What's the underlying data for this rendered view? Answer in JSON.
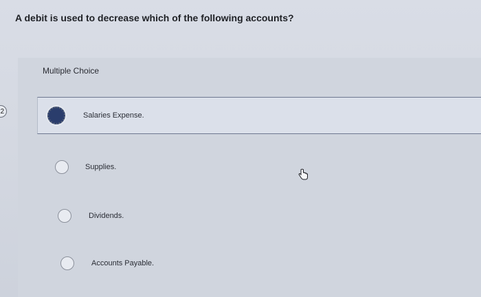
{
  "question": {
    "text": "A debit is used to decrease which of the following accounts?"
  },
  "question_type": "Multiple Choice",
  "question_number": "2",
  "options": [
    {
      "label": "Salaries Expense.",
      "selected": true
    },
    {
      "label": "Supplies.",
      "selected": false
    },
    {
      "label": "Dividends.",
      "selected": false
    },
    {
      "label": "Accounts Payable.",
      "selected": false
    }
  ],
  "colors": {
    "selected_radio": "#2a3d6c",
    "selected_border": "#6d7890"
  },
  "icons": {
    "cursor": "hand-pointer-icon"
  }
}
